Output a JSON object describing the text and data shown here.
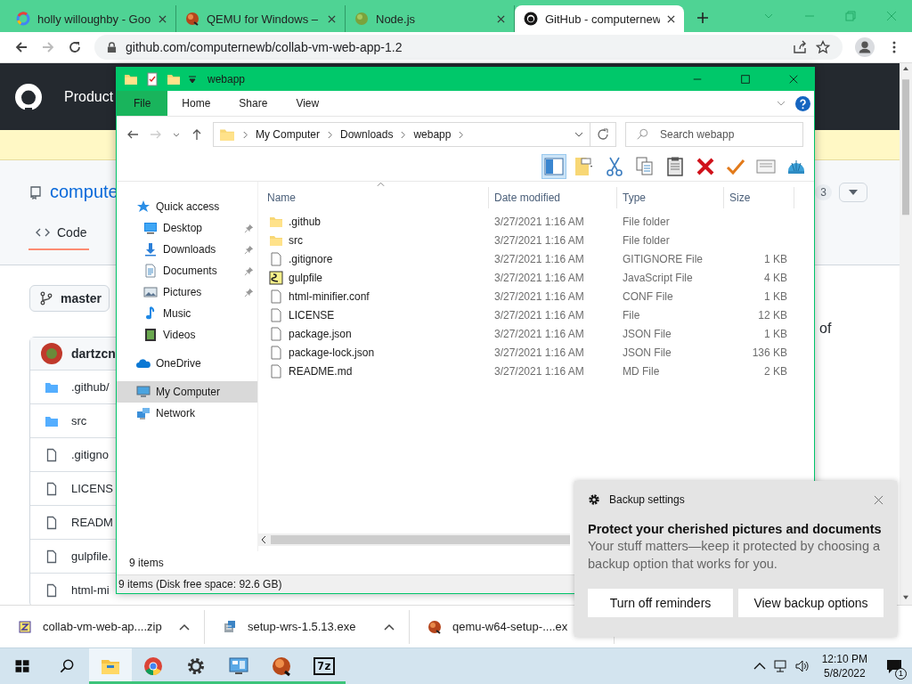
{
  "browser": {
    "tabs": [
      {
        "title": "holly willoughby - Goo",
        "kind": "ring",
        "selected": false
      },
      {
        "title": "QEMU for Windows –",
        "kind": "ball",
        "selected": false
      },
      {
        "title": "Node.js",
        "kind": "sphere",
        "selected": false
      },
      {
        "title": "GitHub - computernew",
        "kind": "cat",
        "selected": true
      }
    ],
    "url": "github.com/computernewb/collab-vm-web-app-1.2"
  },
  "github": {
    "nav": "Product",
    "repo": "compute",
    "count": "3",
    "tab": "Code",
    "branch": "master",
    "author": "dartzcn",
    "aside": "of",
    "files": [
      {
        "name": ".github/",
        "kind": "folder"
      },
      {
        "name": "src",
        "kind": "folder"
      },
      {
        "name": ".gitigno",
        "kind": "file"
      },
      {
        "name": "LICENS",
        "kind": "file"
      },
      {
        "name": "READM",
        "kind": "file"
      },
      {
        "name": "gulpfile.",
        "kind": "file"
      },
      {
        "name": "html-mi",
        "kind": "file"
      }
    ]
  },
  "explorer": {
    "title": "webapp",
    "ribbon": [
      {
        "label": "File",
        "kind": "file"
      },
      {
        "label": "Home",
        "kind": "tab"
      },
      {
        "label": "Share",
        "kind": "tab"
      },
      {
        "label": "View",
        "kind": "tab"
      }
    ],
    "path": [
      "My Computer",
      "Downloads",
      "webapp"
    ],
    "search": {
      "placeholder": "Search webapp"
    },
    "toolbar": [
      {
        "kind": "pane",
        "selected": true
      },
      {
        "kind": "view",
        "selected": false
      },
      {
        "kind": "cut",
        "selected": false
      },
      {
        "kind": "copy",
        "selected": false
      },
      {
        "kind": "paste",
        "selected": false
      },
      {
        "kind": "delete",
        "selected": false
      },
      {
        "kind": "check",
        "selected": false
      },
      {
        "kind": "card",
        "selected": false
      },
      {
        "kind": "shell",
        "selected": false
      }
    ],
    "nav": [
      {
        "label": "Quick access",
        "kind": "star",
        "selected": false,
        "children": [
          {
            "label": "Desktop",
            "kind": "desktop",
            "pinned": true,
            "selected": false
          },
          {
            "label": "Downloads",
            "kind": "downloads",
            "pinned": true,
            "selected": false
          },
          {
            "label": "Documents",
            "kind": "documents",
            "pinned": true,
            "selected": false
          },
          {
            "label": "Pictures",
            "kind": "pictures",
            "pinned": true,
            "selected": false
          },
          {
            "label": "Music",
            "kind": "music",
            "pinned": false,
            "selected": false
          },
          {
            "label": "Videos",
            "kind": "videos",
            "pinned": false,
            "selected": false
          }
        ]
      },
      {
        "label": "OneDrive",
        "kind": "cloud",
        "selected": false
      },
      {
        "label": "My Computer",
        "kind": "computer",
        "selected": true
      },
      {
        "label": "Network",
        "kind": "network",
        "selected": false
      }
    ],
    "columns": [
      "Name",
      "Date modified",
      "Type",
      "Size"
    ],
    "files": [
      {
        "name": ".github",
        "date": "3/27/2021 1:16 AM",
        "type": "File folder",
        "kind": "folder"
      },
      {
        "name": "src",
        "date": "3/27/2021 1:16 AM",
        "type": "File folder",
        "kind": "folder"
      },
      {
        "name": ".gitignore",
        "date": "3/27/2021 1:16 AM",
        "type": "GITIGNORE File",
        "size": "1 KB",
        "kind": "file"
      },
      {
        "name": "gulpfile",
        "date": "3/27/2021 1:16 AM",
        "type": "JavaScript File",
        "size": "4 KB",
        "kind": "script"
      },
      {
        "name": "html-minifier.conf",
        "date": "3/27/2021 1:16 AM",
        "type": "CONF File",
        "size": "1 KB",
        "kind": "file"
      },
      {
        "name": "LICENSE",
        "date": "3/27/2021 1:16 AM",
        "type": "File",
        "size": "12 KB",
        "kind": "file"
      },
      {
        "name": "package.json",
        "date": "3/27/2021 1:16 AM",
        "type": "JSON File",
        "size": "1 KB",
        "kind": "file"
      },
      {
        "name": "package-lock.json",
        "date": "3/27/2021 1:16 AM",
        "type": "JSON File",
        "size": "136 KB",
        "kind": "file"
      },
      {
        "name": "README.md",
        "date": "3/27/2021 1:16 AM",
        "type": "MD File",
        "size": "2 KB",
        "kind": "file"
      }
    ],
    "count": "9 items",
    "status": "9 items (Disk free space: 92.6 GB)"
  },
  "downloads": [
    {
      "name": "collab-vm-web-ap....zip",
      "kind": "zip",
      "caret": true
    },
    {
      "name": "setup-wrs-1.5.13.exe",
      "kind": "installer",
      "caret": true
    },
    {
      "name": "qemu-w64-setup-....ex",
      "kind": "ball"
    }
  ],
  "notification": {
    "source": "Backup settings",
    "title": "Protect your cherished pictures and documents",
    "body": "Your stuff matters—keep it protected by choosing a backup option that works for you.",
    "buttons": [
      "Turn off reminders",
      "View backup options"
    ]
  },
  "taskbar": {
    "apps": [
      {
        "kind": "explorer",
        "selected": true
      },
      {
        "kind": "chrome",
        "selected": false
      },
      {
        "kind": "settings",
        "selected": false
      },
      {
        "kind": "control",
        "selected": false
      },
      {
        "kind": "qemu",
        "selected": false
      },
      {
        "kind": "sevenzip",
        "label": "7z",
        "selected": false
      }
    ],
    "time": "12:10 PM",
    "date": "5/8/2022",
    "badge": "1"
  }
}
